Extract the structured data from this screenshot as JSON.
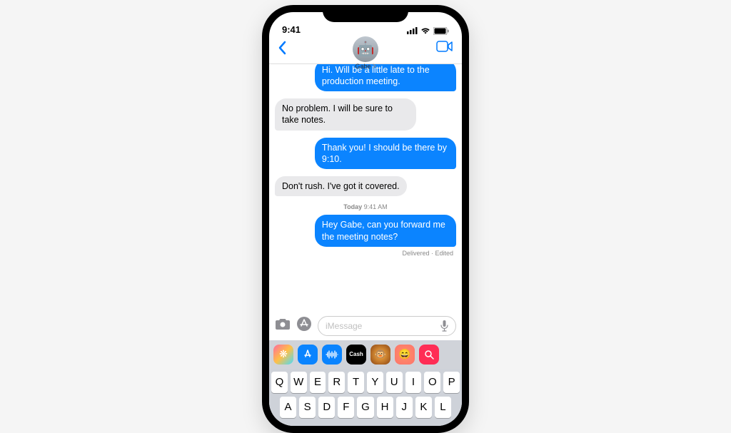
{
  "status": {
    "time": "9:41"
  },
  "header": {
    "contact_name": "Gabe",
    "contact_emoji": "🤖"
  },
  "messages": {
    "m0": "Hi. Will be a little late to the production meeting.",
    "m1": "No problem. I will be sure to take notes.",
    "m2": "Thank you! I should be there by 9:10.",
    "m3": "Don't rush. I've got it covered.",
    "m4": "Hey Gabe, can you forward me the meeting notes?"
  },
  "divider": {
    "day": "Today",
    "time": "9:41 AM"
  },
  "delivery_status": "Delivered · Edited",
  "input": {
    "placeholder": "iMessage"
  },
  "apps": {
    "a0": "Photos",
    "a1": "Store",
    "a2": "Audio",
    "a3": "Cash",
    "a4": "Memoji",
    "a5": "Stickers",
    "a6": "Search"
  },
  "keyboard": {
    "r1": [
      "Q",
      "W",
      "E",
      "R",
      "T",
      "Y",
      "U",
      "I",
      "O",
      "P"
    ],
    "r2": [
      "A",
      "S",
      "D",
      "F",
      "G",
      "H",
      "J",
      "K",
      "L"
    ]
  }
}
